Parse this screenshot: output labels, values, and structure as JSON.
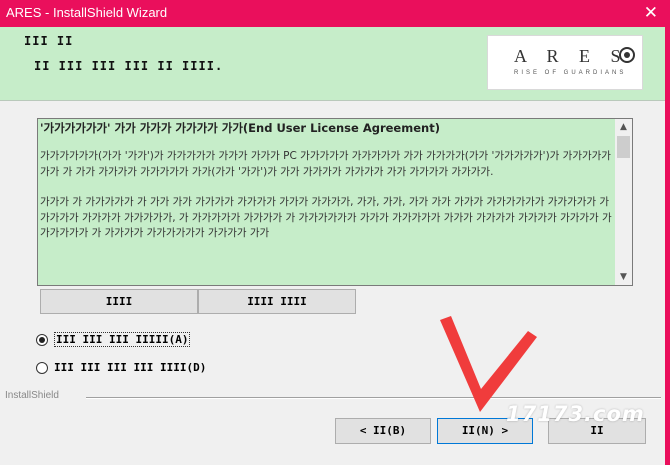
{
  "window": {
    "title": "ARES - InstallShield Wizard"
  },
  "header": {
    "title": "III II",
    "subtitle": "II III III III II IIII.",
    "logo": {
      "text": "A R E S",
      "tagline": "RISE OF GUARDIANS"
    }
  },
  "license": {
    "title": "'가가가가가가' 가가 가가가 가가가가 가가(End User License Agreement)",
    "paragraphs": [
      "가가가가가가(가가 '가가')가 가가가가가 가가가 가가가 PC 가가가가가 가가가가가 가가 가가가가(가가 '가가가가가')가 가가가가가 가가 가 가가 가가가가 가가가가가 가가(가가 '가가')가 가가 가가가가 가가가가 가가 가가가가 가가가가.",
      "가가가 가 가가가가가 가 가가 가가 가가가가 가가가가 가가가 가가가가, 가가, 가가, 가가 가가 가가가 가가가가가가 가가가가가 가 가가가가 가가가가 가가가가가, 가 가가가가가 가가가가 가 가가가가가가 가가가 가가가가가 가가가 가가가가 가가가가 가가가가 가가가가가가 가 가가가가 가가가가가가 가가가가 가가"
    ]
  },
  "buttons": {
    "print": "IIII",
    "save": "IIII IIII",
    "back": "< II(B)",
    "next": "II(N) >",
    "cancel": "II"
  },
  "options": {
    "accept": "III III III IIIII(A)",
    "decline": "III III III III IIII(D)"
  },
  "footer": {
    "brand": "InstallShield"
  },
  "watermark": "17173.com",
  "colors": {
    "titlebar": "#ea0f5c",
    "header_bg": "#c6edc9",
    "arrow": "#f03c3c"
  }
}
